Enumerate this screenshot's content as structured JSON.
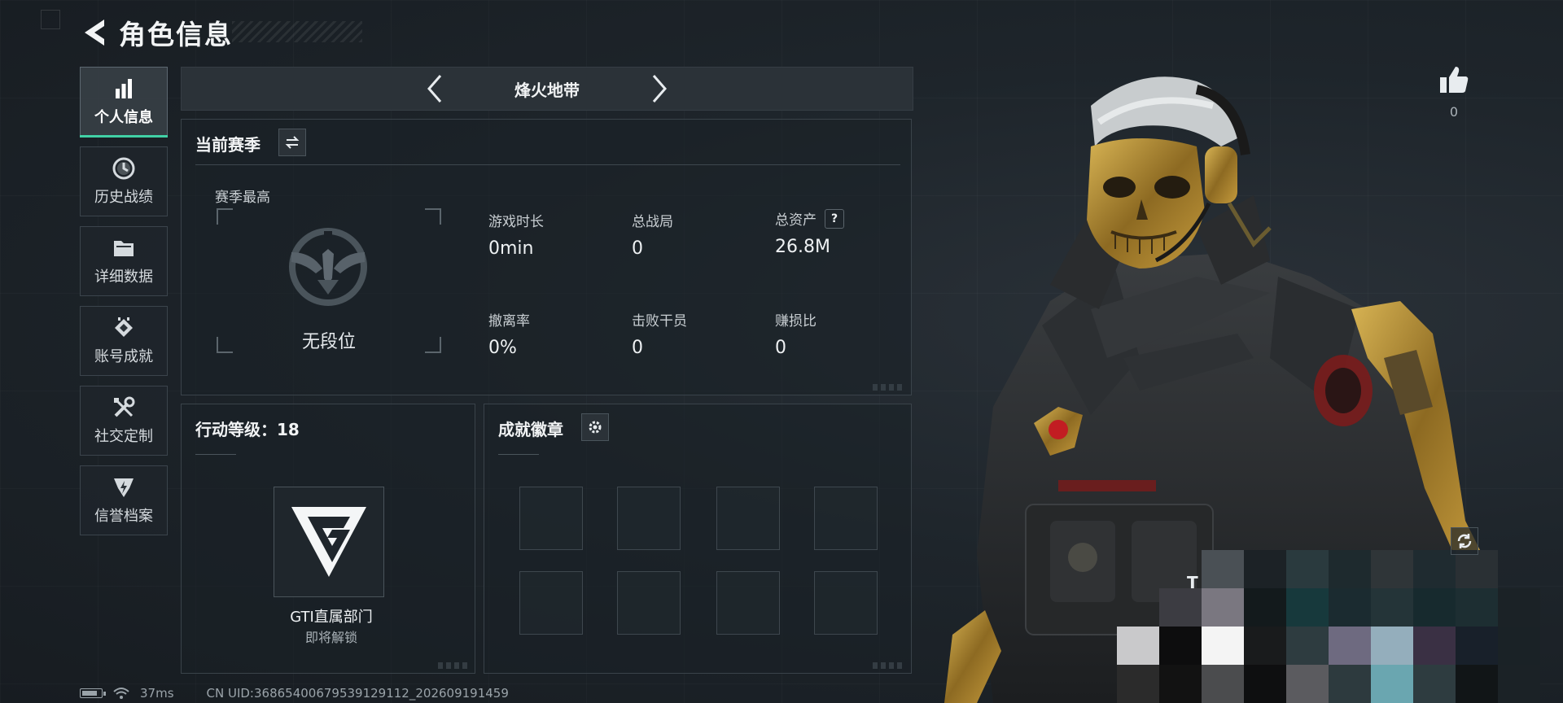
{
  "header": {
    "title": "角色信息"
  },
  "sidebar": {
    "items": [
      {
        "label": "个人信息",
        "icon": "bar-chart-icon",
        "active": true
      },
      {
        "label": "历史战绩",
        "icon": "history-clock-icon",
        "active": false
      },
      {
        "label": "详细数据",
        "icon": "folder-icon",
        "active": false
      },
      {
        "label": "账号成就",
        "icon": "achievement-gem-icon",
        "active": false
      },
      {
        "label": "社交定制",
        "icon": "tools-icon",
        "active": false
      },
      {
        "label": "信誉档案",
        "icon": "shield-bolt-icon",
        "active": false
      }
    ]
  },
  "mode": {
    "name": "烽火地带"
  },
  "season": {
    "title": "当前赛季",
    "best_label": "赛季最高",
    "rank_name": "无段位",
    "stats": [
      {
        "key": "游戏时长",
        "value": "0min"
      },
      {
        "key": "总战局",
        "value": "0"
      },
      {
        "key": "总资产",
        "value": "26.8M",
        "help": "?"
      },
      {
        "key": "撤离率",
        "value": "0%"
      },
      {
        "key": "击败干员",
        "value": "0"
      },
      {
        "key": "赚损比",
        "value": "0"
      }
    ]
  },
  "action_level": {
    "title": "行动等级：18",
    "unit_name": "GTI直属部门",
    "unit_status": "即将解锁"
  },
  "achievements": {
    "title": "成就徽章",
    "slots": 8
  },
  "likes": {
    "count": "0"
  },
  "status": {
    "ping": "37ms",
    "uid": "CN UID:3686540067953912911​2_202609191459"
  },
  "mosaic_letter": "T",
  "colors": {
    "accent": "#41d1a6",
    "panel_border": "#3a434a",
    "background": "#1b2127"
  }
}
